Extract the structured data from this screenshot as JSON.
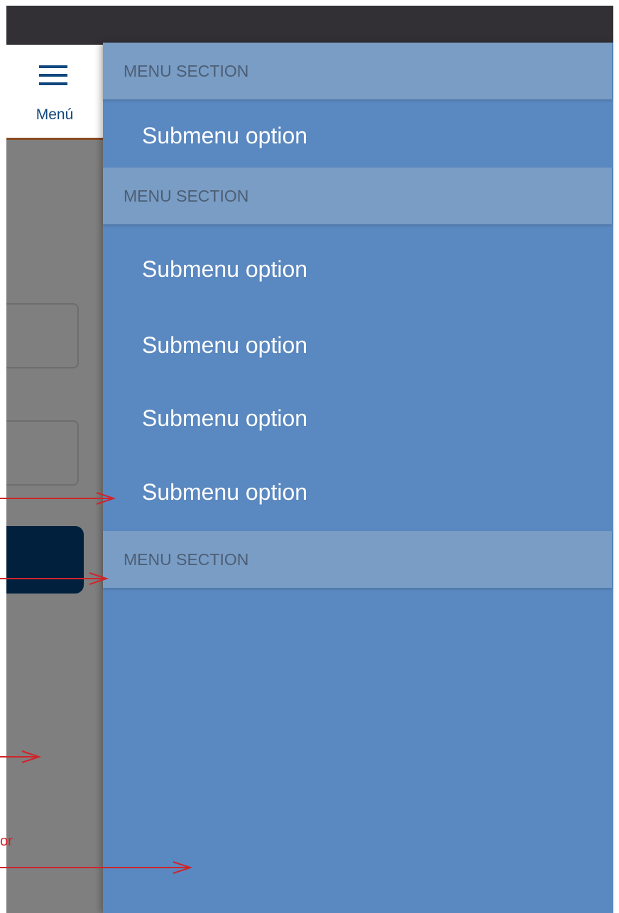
{
  "header": {
    "menu_label": "Menú"
  },
  "drawer": {
    "sections": [
      {
        "label": "MENU SECTION"
      },
      {
        "label": "MENU SECTION"
      },
      {
        "label": "MENU SECTION"
      }
    ],
    "items": [
      {
        "label": "Submenu option"
      },
      {
        "label": "Submenu option"
      },
      {
        "label": "Submenu option"
      },
      {
        "label": "Submenu option"
      },
      {
        "label": "Submenu option"
      }
    ]
  },
  "annotation": {
    "fragment_text": "or",
    "color": "#d0242a"
  },
  "colors": {
    "drawer_bg": "#5a88c0",
    "section_bg": "#7a9dc5",
    "header_brand": "#10477e",
    "status_bar": "#323035",
    "overlay_dim": "#7f7f7f",
    "dark_button": "#00203d"
  }
}
